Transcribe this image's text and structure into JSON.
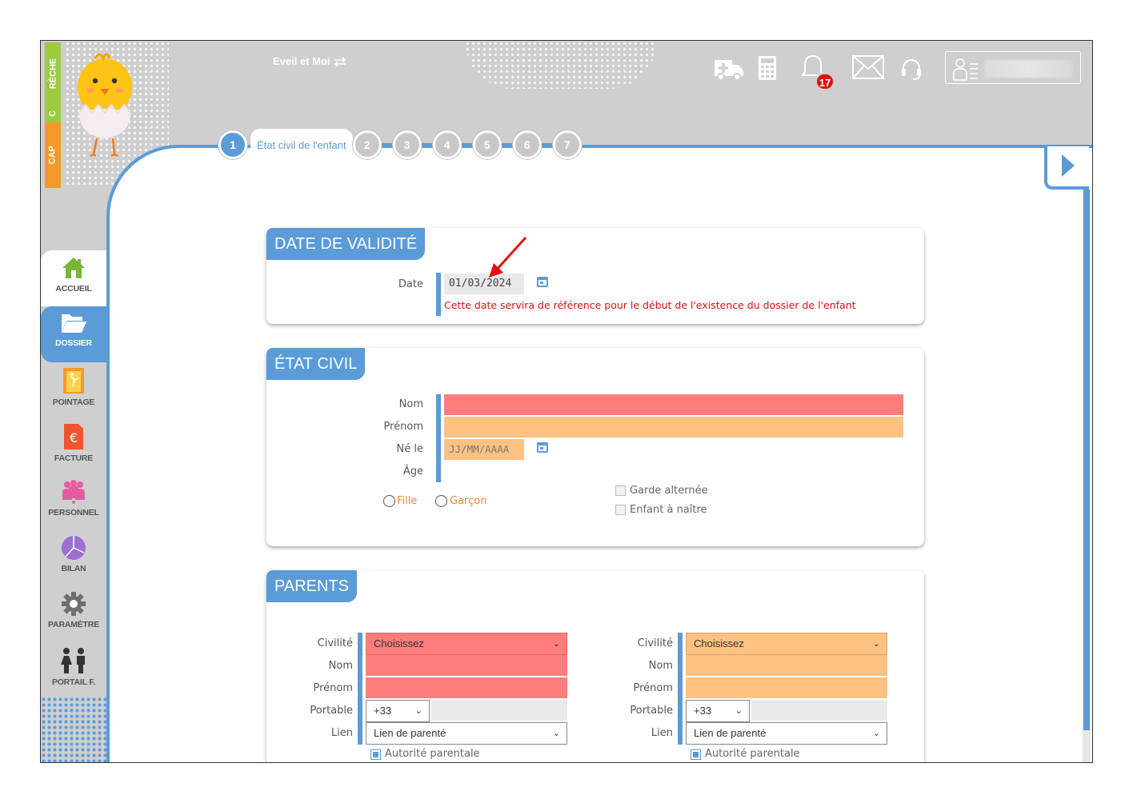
{
  "header": {
    "brand_top": "CAP",
    "brand_mid": "C",
    "brand_bottom": "RÈCHE",
    "app_name": "Eveil et Moi",
    "switch_icon": "swap-arrows-icon",
    "notifications_count": "17",
    "icons": [
      "ambulance-icon",
      "calculator-icon",
      "bell-icon",
      "mail-icon",
      "headset-icon",
      "user-card-icon"
    ]
  },
  "steps": {
    "items": [
      "1",
      "2",
      "3",
      "4",
      "5",
      "6",
      "7"
    ],
    "active_label": "État civil de l'enfant"
  },
  "sidebar": {
    "items": [
      {
        "label": "ACCUEIL",
        "icon": "house-icon"
      },
      {
        "label": "DOSSIER",
        "icon": "folder-icon"
      },
      {
        "label": "POINTAGE",
        "icon": "door-icon"
      },
      {
        "label": "FACTURE",
        "icon": "euro-invoice-icon"
      },
      {
        "label": "PERSONNEL",
        "icon": "people-icon"
      },
      {
        "label": "BILAN",
        "icon": "pie-chart-icon"
      },
      {
        "label": "PARAMÈTRE",
        "icon": "gear-icon"
      },
      {
        "label": "PORTAIL F.",
        "icon": "family-icon"
      }
    ]
  },
  "validity": {
    "title": "DATE DE VALIDITÉ",
    "date_label": "Date",
    "date_value": "01/03/2024",
    "hint": "Cette date servira de référence pour le début de l'existence du dossier de l'enfant"
  },
  "etat_civil": {
    "title": "ÉTAT CIVIL",
    "nom_label": "Nom",
    "prenom_label": "Prénom",
    "ne_le_label": "Né le",
    "ne_le_placeholder": "JJ/MM/AAAA",
    "age_label": "Âge",
    "fille_label": "Fille",
    "garcon_label": "Garçon",
    "garde_label": "Garde alternée",
    "enfant_label": "Enfant à naître"
  },
  "parents": {
    "title": "PARENTS",
    "labels": {
      "civilite": "Civilité",
      "nom": "Nom",
      "prenom": "Prénom",
      "portable": "Portable",
      "lien": "Lien"
    },
    "parent1": {
      "civilite_value": "Choisissez",
      "indicatif": "+33",
      "lien_value": "Lien de parenté",
      "autorite_label": "Autorité parentale"
    },
    "parent2": {
      "civilite_value": "Choisissez",
      "indicatif": "+33",
      "lien_value": "Lien de parenté",
      "autorite_label": "Autorité parentale"
    }
  },
  "colors": {
    "accent": "#5b9bd8",
    "required": "#ff7d7d",
    "optional": "#ffc282",
    "error_text": "#e01010",
    "annotation_arrow": "#e01010"
  }
}
